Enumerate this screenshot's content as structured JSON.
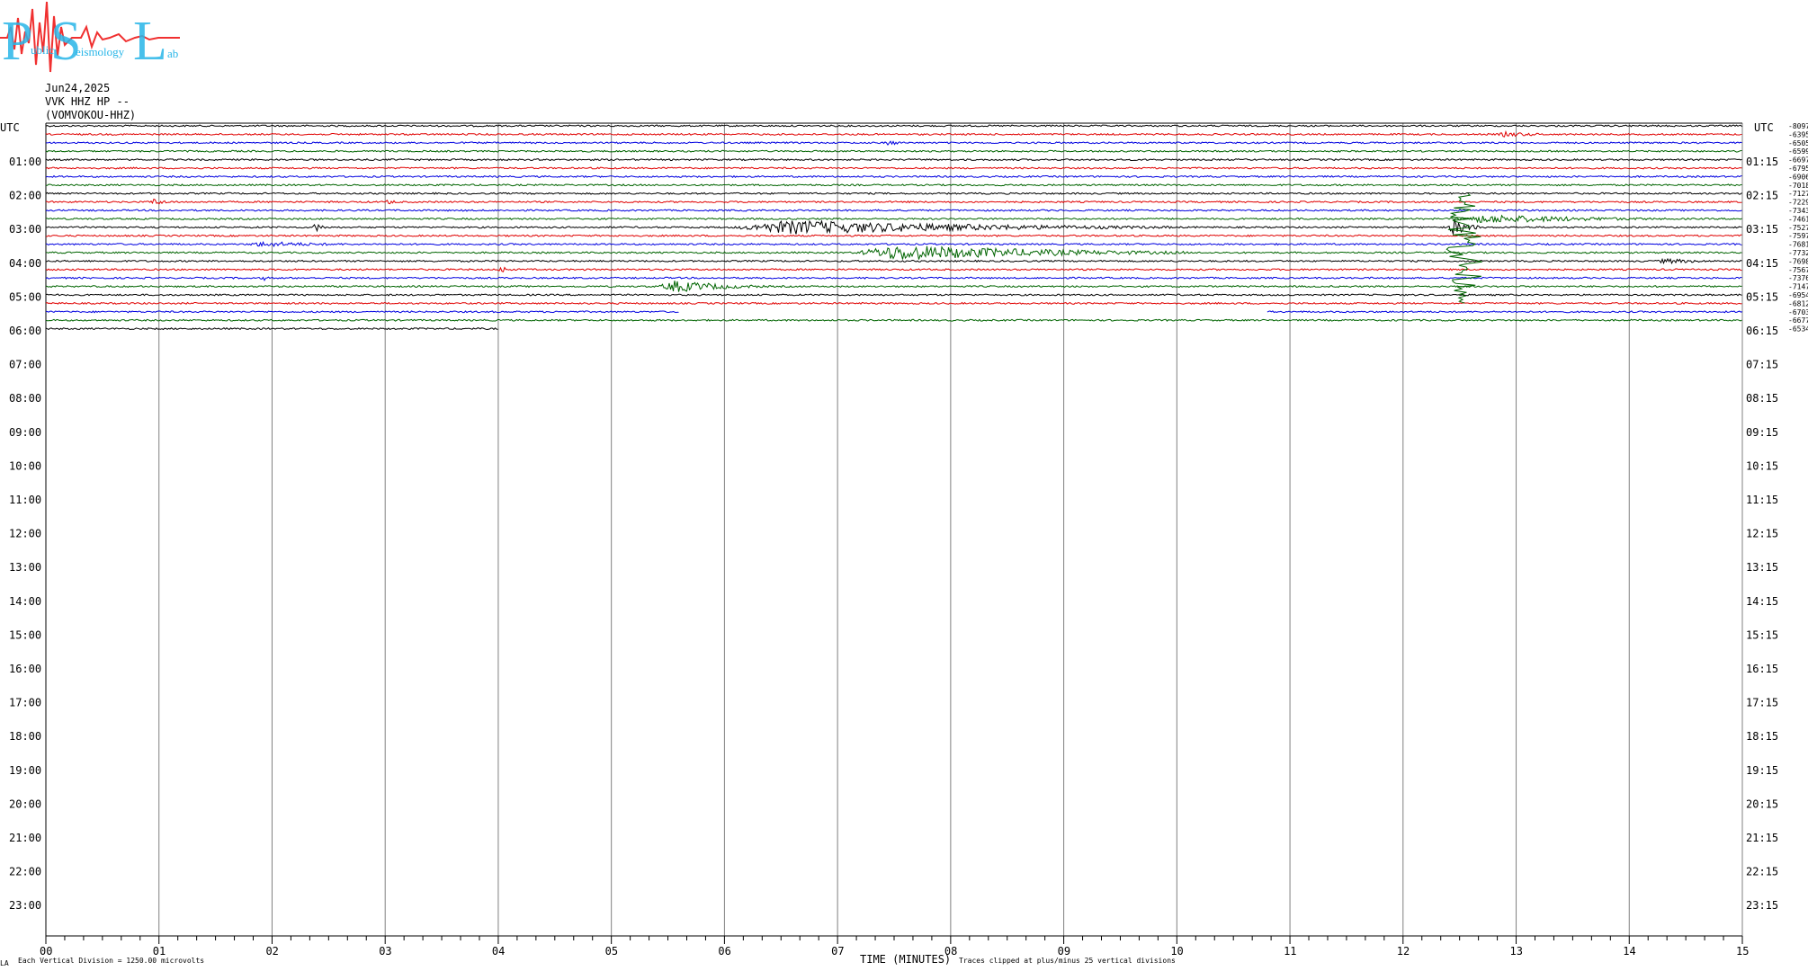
{
  "logo": {
    "letters": [
      "P",
      "S",
      "L"
    ],
    "words": [
      "ublic",
      "eismology",
      "ab"
    ]
  },
  "header": {
    "date": "Jun24,2025",
    "station": "VVK HHZ HP --",
    "channel": "(VOMVOKOU-HHZ)"
  },
  "left_corner_label": "UTC",
  "right_corner_label": "UTC",
  "hours_left": [
    "01:00",
    "02:00",
    "03:00",
    "04:00",
    "05:00",
    "06:00",
    "07:00",
    "08:00",
    "09:00",
    "10:00",
    "11:00",
    "12:00",
    "13:00",
    "14:00",
    "15:00",
    "16:00",
    "17:00",
    "18:00",
    "19:00",
    "20:00",
    "21:00",
    "22:00",
    "23:00"
  ],
  "hours_right": [
    "01:15",
    "02:15",
    "03:15",
    "04:15",
    "05:15",
    "06:15",
    "07:15",
    "08:15",
    "09:15",
    "10:15",
    "11:15",
    "12:15",
    "13:15",
    "14:15",
    "15:15",
    "16:15",
    "17:15",
    "18:15",
    "19:15",
    "20:15",
    "21:15",
    "22:15",
    "23:15"
  ],
  "footer": {
    "xlabel": "TIME (MINUTES)",
    "clip_note": "Traces clipped at plus/minus 25 vertical divisions",
    "scale_note": "Each Vertical Division = 1250.00 microvolts",
    "mark": "LA"
  },
  "colors": {
    "black": "#000000",
    "red": "#e00000",
    "blue": "#0000e0",
    "green": "#006400",
    "grid": "#808080",
    "logo_cyan": "#29b6e8",
    "logo_red": "#f03030"
  },
  "chart_data": {
    "type": "line",
    "xlabel": "TIME (MINUTES)",
    "x_ticks": [
      "00",
      "01",
      "02",
      "03",
      "04",
      "05",
      "06",
      "07",
      "08",
      "09",
      "10",
      "11",
      "12",
      "13",
      "14",
      "15"
    ],
    "xlim": [
      0,
      15
    ],
    "trace_minutes": 15,
    "color_cycle": [
      "black",
      "red",
      "blue",
      "green"
    ],
    "traces": [
      {
        "start": "00:00",
        "offset": "-8097",
        "color": "black",
        "events": []
      },
      {
        "start": "00:15",
        "offset": "-6395",
        "color": "red",
        "events": [
          {
            "t": 12.8,
            "d": 0.7,
            "a": 3
          }
        ]
      },
      {
        "start": "00:30",
        "offset": "-6505",
        "color": "blue",
        "events": [
          {
            "t": 7.4,
            "d": 0.3,
            "a": 3
          }
        ]
      },
      {
        "start": "00:45",
        "offset": "-6599",
        "color": "green",
        "events": []
      },
      {
        "start": "01:00",
        "offset": "-6697",
        "color": "black",
        "events": []
      },
      {
        "start": "01:15",
        "offset": "-6795",
        "color": "red",
        "events": []
      },
      {
        "start": "01:30",
        "offset": "-6906",
        "color": "blue",
        "events": []
      },
      {
        "start": "01:45",
        "offset": "-7018",
        "color": "green",
        "events": []
      },
      {
        "start": "02:00",
        "offset": "-7127",
        "color": "black",
        "events": []
      },
      {
        "start": "02:15",
        "offset": "-7229",
        "color": "red",
        "events": [
          {
            "t": 0.9,
            "d": 0.3,
            "a": 4
          },
          {
            "t": 3.0,
            "d": 0.2,
            "a": 3
          }
        ]
      },
      {
        "start": "02:30",
        "offset": "-7343",
        "color": "blue",
        "events": []
      },
      {
        "start": "02:45",
        "offset": "-7461",
        "color": "green",
        "events": [
          {
            "t": 12.4,
            "d": 2.2,
            "a": 5
          }
        ]
      },
      {
        "start": "03:00",
        "offset": "-7527",
        "color": "black",
        "events": [
          {
            "t": 2.35,
            "d": 0.2,
            "a": 5
          },
          {
            "t": 6.0,
            "d": 4.0,
            "a": 8
          },
          {
            "t": 12.4,
            "d": 0.3,
            "a": 10
          }
        ]
      },
      {
        "start": "03:15",
        "offset": "-7597",
        "color": "red",
        "events": []
      },
      {
        "start": "03:30",
        "offset": "-7681",
        "color": "blue",
        "events": [
          {
            "t": 1.7,
            "d": 1.5,
            "a": 3
          }
        ]
      },
      {
        "start": "03:45",
        "offset": "-7732",
        "color": "green",
        "events": [
          {
            "t": 7.1,
            "d": 3.0,
            "a": 9
          }
        ]
      },
      {
        "start": "04:00",
        "offset": "-7698",
        "color": "black",
        "events": [
          {
            "t": 14.2,
            "d": 0.8,
            "a": 3
          }
        ]
      },
      {
        "start": "04:15",
        "offset": "-7567",
        "color": "red",
        "events": [
          {
            "t": 4.0,
            "d": 0.15,
            "a": 5
          }
        ]
      },
      {
        "start": "04:30",
        "offset": "-7376",
        "color": "blue",
        "events": [
          {
            "t": 1.9,
            "d": 0.1,
            "a": 4
          }
        ]
      },
      {
        "start": "04:45",
        "offset": "-7147",
        "color": "green",
        "events": [
          {
            "t": 5.4,
            "d": 1.0,
            "a": 7
          }
        ]
      },
      {
        "start": "05:00",
        "offset": "-6954",
        "color": "black",
        "events": []
      },
      {
        "start": "05:15",
        "offset": "-6812",
        "color": "red",
        "events": []
      },
      {
        "start": "05:30",
        "offset": "-6703",
        "color": "blue",
        "events": [],
        "gap": [
          5.6,
          10.8
        ]
      },
      {
        "start": "05:45",
        "offset": "-6677",
        "color": "green",
        "events": []
      },
      {
        "start": "06:00",
        "offset": "-6534",
        "color": "black",
        "events": [],
        "end": 4.0
      }
    ],
    "big_event": {
      "t": 12.55,
      "from_trace": 8,
      "to_trace": 21,
      "color": "green"
    }
  }
}
